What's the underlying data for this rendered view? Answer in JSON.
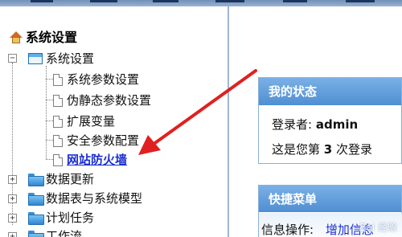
{
  "sidebar": {
    "root_label": "系统设置",
    "group_label": "系统设置",
    "items": [
      {
        "label": "系统参数设置"
      },
      {
        "label": "伪静态参数设置"
      },
      {
        "label": "扩展变量"
      },
      {
        "label": "安全参数配置"
      },
      {
        "label": "网站防火墙",
        "selected": true
      }
    ],
    "collapsed_groups": [
      {
        "label": "数据更新"
      },
      {
        "label": "数据表与系统模型"
      },
      {
        "label": "计划任务"
      },
      {
        "label": "工作流"
      }
    ]
  },
  "main": {
    "status_card": {
      "title": "我的状态",
      "login_prefix": "登录者:",
      "username": "admin",
      "visit_prefix": "这是您第",
      "visit_count": "3",
      "visit_suffix": "次登录"
    },
    "quick_menu": {
      "title": "快捷菜单",
      "info_label": "信息操作:",
      "add_info_link": "增加信息"
    }
  },
  "watermark": "Bai 经验",
  "colors": {
    "selected_link": "#1a2fd0",
    "card_header": "#5b98d8",
    "arrow": "#e02020"
  }
}
